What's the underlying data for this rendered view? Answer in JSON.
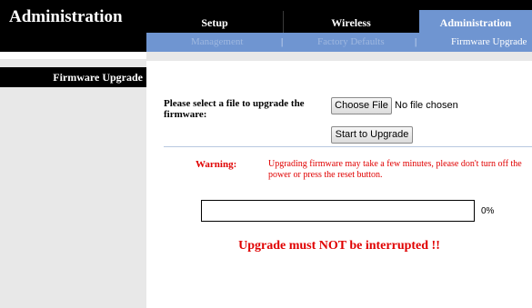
{
  "header": {
    "title": "Administration",
    "tabs": [
      {
        "label": "Setup"
      },
      {
        "label": "Wireless"
      },
      {
        "label": "Administration",
        "active": true
      }
    ],
    "subnav": [
      {
        "label": "Management"
      },
      {
        "label": "Factory Defaults"
      },
      {
        "label": "Firmware Upgrade",
        "active": true
      }
    ],
    "separator": "|"
  },
  "sidebar": {
    "section_title": "Firmware Upgrade"
  },
  "main": {
    "prompt": "Please select a file to upgrade the firmware:",
    "choose_file_label": "Choose File",
    "file_status": "No file chosen",
    "start_button_label": "Start to Upgrade",
    "warning_label": "Warning:",
    "warning_text": "Upgrading firmware may take a few minutes, please don't turn off the power or press the reset button.",
    "progress_percent": 0,
    "progress_text": "0%",
    "notice": "Upgrade must NOT be interrupted !!"
  },
  "colors": {
    "accent_blue": "#6f95d1",
    "header_black": "#000000",
    "warning_red": "#e00000"
  }
}
